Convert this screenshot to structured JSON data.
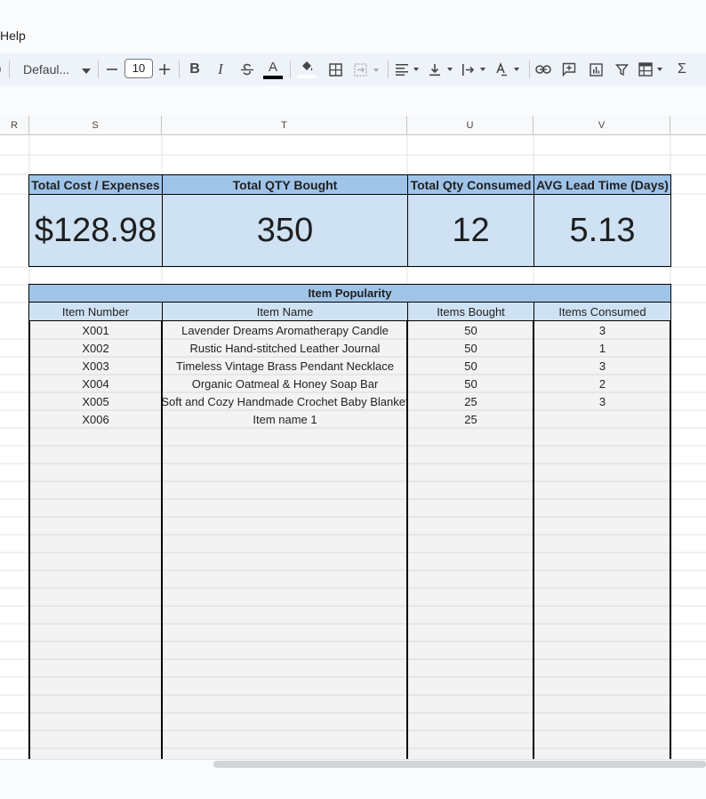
{
  "menu": {
    "help_label": "Help"
  },
  "toolbar": {
    "font_name": "Defaul...",
    "font_size": "10",
    "minus": "−",
    "plus": "+",
    "bold": "B",
    "italic": "I",
    "text_color": "A",
    "sum": "Σ",
    "icons": [
      "format-painter-icon",
      "font-caret-icon",
      "decrease-font-icon",
      "increase-font-icon",
      "bold-icon",
      "italic-icon",
      "strikethrough-icon",
      "text-color-icon",
      "fill-color-icon",
      "borders-icon",
      "merge-cells-icon",
      "align-icon",
      "vertical-align-icon",
      "text-wrap-icon",
      "text-rotation-icon",
      "link-icon",
      "comment-icon",
      "chart-icon",
      "filter-icon",
      "table-icon",
      "functions-icon"
    ]
  },
  "columns": [
    "R",
    "S",
    "T",
    "U",
    "V"
  ],
  "summary": {
    "headers": [
      "Total Cost / Expenses",
      "Total QTY Bought",
      "Total Qty Consumed",
      "AVG Lead Time (Days)"
    ],
    "values": [
      "$128.98",
      "350",
      "12",
      "5.13"
    ]
  },
  "popularity": {
    "title": "Item Popularity",
    "headers": [
      "Item Number",
      "Item Name",
      "Items Bought",
      "Items Consumed"
    ],
    "rows": [
      [
        "X001",
        "Lavender Dreams Aromatherapy Candle",
        "50",
        "3"
      ],
      [
        "X002",
        "Rustic Hand-stitched Leather Journal",
        "50",
        "1"
      ],
      [
        "X003",
        "Timeless Vintage Brass Pendant Necklace",
        "50",
        "3"
      ],
      [
        "X004",
        "Organic Oatmeal & Honey Soap Bar",
        "50",
        "2"
      ],
      [
        "X005",
        "Soft and Cozy Handmade Crochet Baby Blanket",
        "25",
        "3"
      ],
      [
        "X006",
        "Item name 1",
        "25",
        ""
      ]
    ]
  },
  "colors": {
    "header_blue": "#a0c4e8",
    "value_blue": "#cfe2f3",
    "table_body": "#f3f3f3",
    "toolbar_bg": "#eef2f9"
  }
}
